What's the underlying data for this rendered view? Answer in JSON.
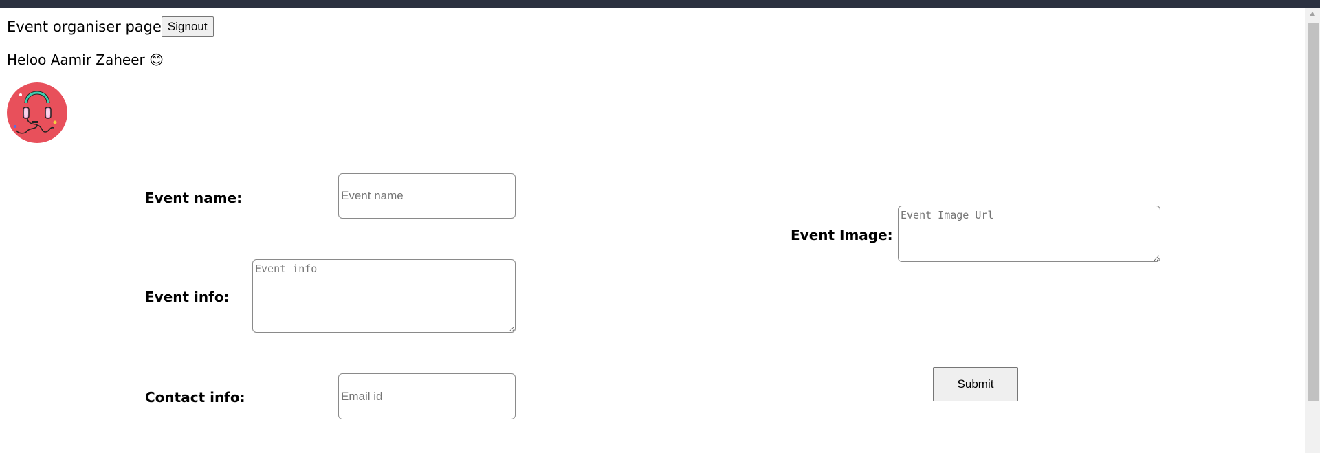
{
  "header": {
    "title": "Event organiser page",
    "signout_label": "Signout",
    "greeting": "Heloo Aamir Zaheer 😊"
  },
  "avatar": {
    "icon": "headphones-icon",
    "background": "#e8505b"
  },
  "form": {
    "event_name": {
      "label": "Event name:",
      "placeholder": "Event name",
      "value": ""
    },
    "event_info": {
      "label": "Event info:",
      "placeholder": "Event info",
      "value": ""
    },
    "contact_info": {
      "label": "Contact info:",
      "placeholder": "Email id",
      "value": ""
    },
    "event_image": {
      "label": "Event Image:",
      "placeholder": "Event Image Url",
      "value": ""
    },
    "submit_label": "Submit"
  }
}
